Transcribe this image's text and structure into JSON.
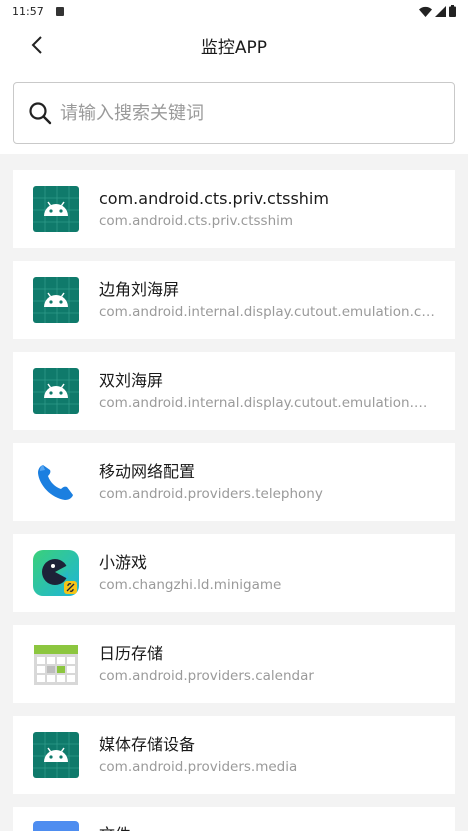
{
  "status_bar": {
    "time": "11:57"
  },
  "header": {
    "title": "监控APP"
  },
  "search": {
    "placeholder": "请输入搜索关键词"
  },
  "apps": [
    {
      "name": "com.android.cts.priv.ctsshim",
      "package": "com.android.cts.priv.ctsshim",
      "icon": "android-icon"
    },
    {
      "name": "边角刘海屏",
      "package": "com.android.internal.display.cutout.emulation.corner",
      "icon": "android-icon"
    },
    {
      "name": "双刘海屏",
      "package": "com.android.internal.display.cutout.emulation.double",
      "icon": "android-icon"
    },
    {
      "name": "移动网络配置",
      "package": "com.android.providers.telephony",
      "icon": "phone-icon"
    },
    {
      "name": "小游戏",
      "package": "com.changzhi.ld.minigame",
      "icon": "minigame-icon"
    },
    {
      "name": "日历存储",
      "package": "com.android.providers.calendar",
      "icon": "calendar-storage-icon"
    },
    {
      "name": "媒体存储设备",
      "package": "com.android.providers.media",
      "icon": "android-icon"
    }
  ],
  "partial_item": {
    "name": "文件"
  },
  "colors": {
    "android_tile": "#0f7a6b",
    "accent_phone": "#1b7fe0"
  }
}
